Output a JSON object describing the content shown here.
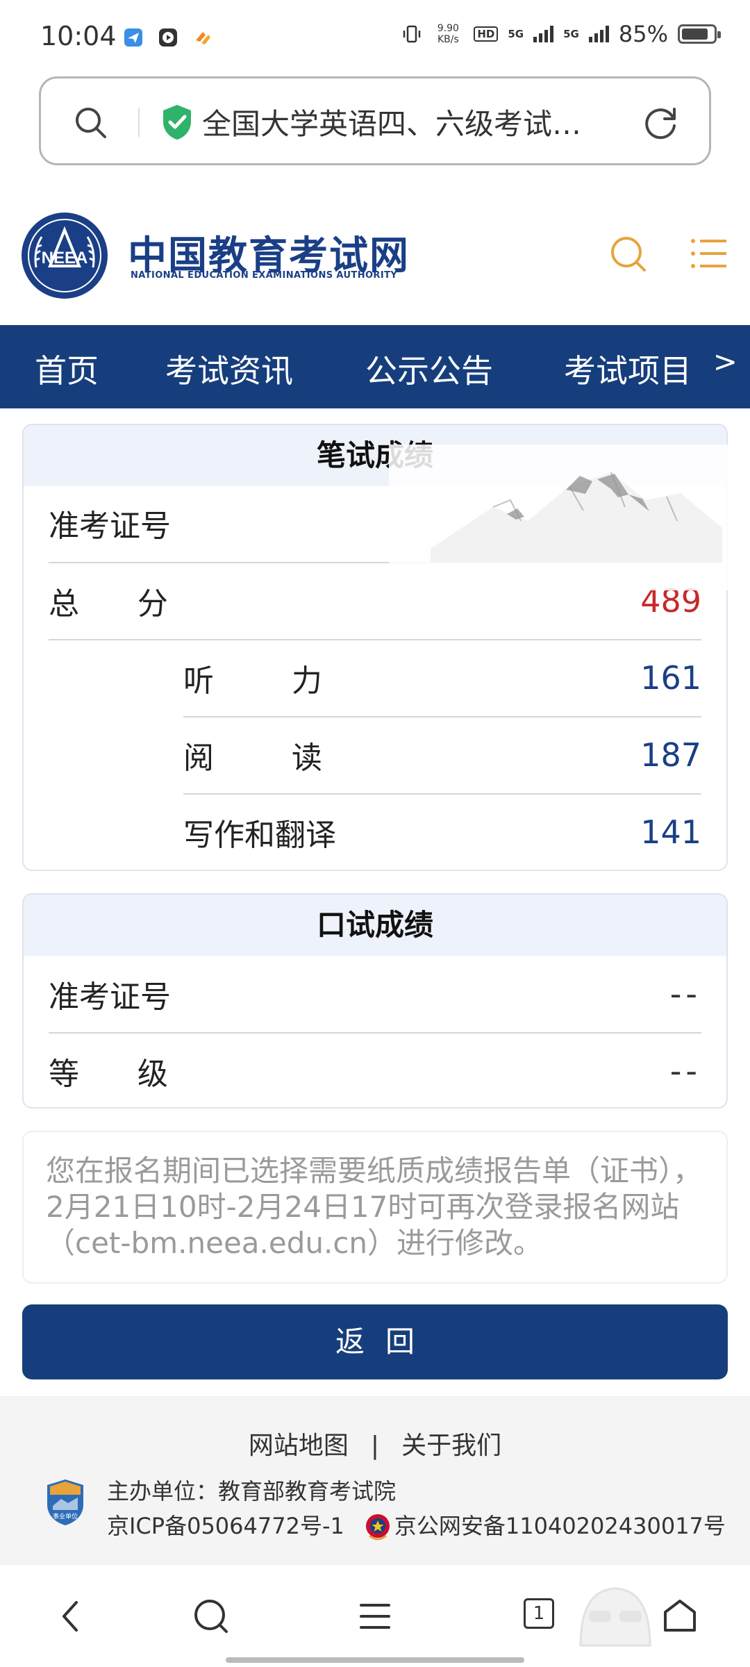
{
  "status_bar": {
    "time": "10:04",
    "net_speed_value": "9.90",
    "net_speed_unit": "KB/s",
    "hd_label": "HD",
    "signal_1_label": "5G",
    "signal_2_label": "5G",
    "battery_percent": "85%",
    "battery_level": 0.85
  },
  "address_bar": {
    "title": "全国大学英语四、六级考试…",
    "secure_icon": "shield-check-icon"
  },
  "site": {
    "logo_emblem_text": "NEEA",
    "name": "中国教育考试网",
    "name_en": "NATIONAL EDUCATION EXAMINATIONS AUTHORITY"
  },
  "nav": {
    "items": [
      {
        "label": "首页"
      },
      {
        "label": "考试资讯"
      },
      {
        "label": "公示公告"
      },
      {
        "label": "考试项目"
      }
    ],
    "more": ">"
  },
  "written": {
    "title": "笔试成绩",
    "ticket_label": "准考证号",
    "ticket_value": "",
    "total_label": "总      分",
    "total_value": "489",
    "listening_label": "听        力",
    "listening_value": "161",
    "reading_label": "阅        读",
    "reading_value": "187",
    "writing_label": "写作和翻译",
    "writing_value": "141"
  },
  "oral": {
    "title": "口试成绩",
    "ticket_label": "准考证号",
    "ticket_value": "--",
    "grade_label": "等      级",
    "grade_value": "--"
  },
  "notice": {
    "text": "您在报名期间已选择需要纸质成绩报告单（证书），2月21日10时-2月24日17时可再次登录报名网站（cet-bm.neea.edu.cn）进行修改。"
  },
  "back_button_label": "返回",
  "footer": {
    "sitemap": "网站地图",
    "separator": "|",
    "about": "关于我们",
    "host": "主办单位：教育部教育考试院",
    "icp": "京ICP备05064772号-1",
    "police": "京公网安备11040202430017号",
    "badge_text": "事业单位"
  },
  "bottom_bar": {
    "tab_count": "1"
  },
  "colors": {
    "brand_blue": "#163e7c",
    "accent_orange": "#e8a33b",
    "total_red": "#c62a2a"
  }
}
